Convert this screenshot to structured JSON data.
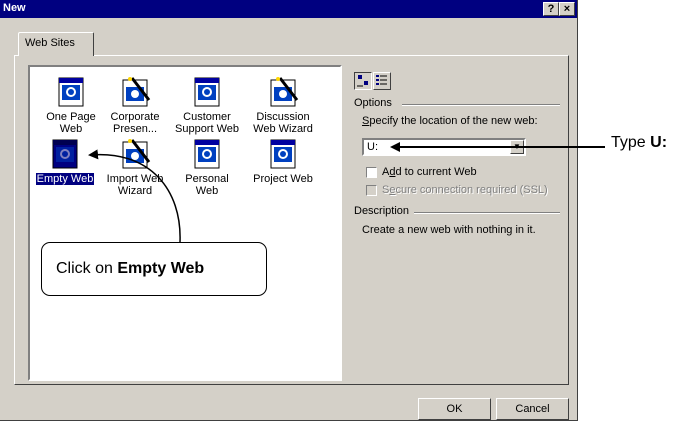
{
  "window": {
    "title": "New",
    "help_btn": "?",
    "close_btn": "×"
  },
  "tabs": [
    {
      "label": "Web Sites"
    }
  ],
  "templates": [
    {
      "label": "One Page Web",
      "icon": "web-page-icon",
      "selected": false
    },
    {
      "label": "Corporate Presen...",
      "icon": "wizard-icon",
      "selected": false
    },
    {
      "label": "Customer Support Web",
      "icon": "web-page-icon",
      "selected": false
    },
    {
      "label": "Discussion Web Wizard",
      "icon": "wizard-icon",
      "selected": false
    },
    {
      "label": "Empty Web",
      "icon": "web-page-icon",
      "selected": true
    },
    {
      "label": "Import Web Wizard",
      "icon": "wizard-icon",
      "selected": false
    },
    {
      "label": "Personal Web",
      "icon": "web-page-icon",
      "selected": false
    },
    {
      "label": "Project Web",
      "icon": "web-page-icon",
      "selected": false
    }
  ],
  "options": {
    "group_label": "Options",
    "location_prefix": "S",
    "location_rest": "pecify the location of the new web:",
    "location_value": "U:",
    "add_prefix": "A",
    "add_u": "d",
    "add_rest": "d to current Web",
    "secure_prefix": "S",
    "secure_u": "e",
    "secure_rest": "cure connection required (SSL)"
  },
  "description": {
    "group_label": "Description",
    "text": "Create a new web with nothing in it."
  },
  "buttons": {
    "ok": "OK",
    "cancel": "Cancel"
  },
  "annotations": {
    "callout_prefix": "Click on ",
    "callout_bold": "Empty Web",
    "type_prefix": "Type ",
    "type_bold": "U:"
  },
  "colors": {
    "title_bar": "#000080",
    "dialog_face": "#d4d0c8",
    "selection": "#000080"
  }
}
